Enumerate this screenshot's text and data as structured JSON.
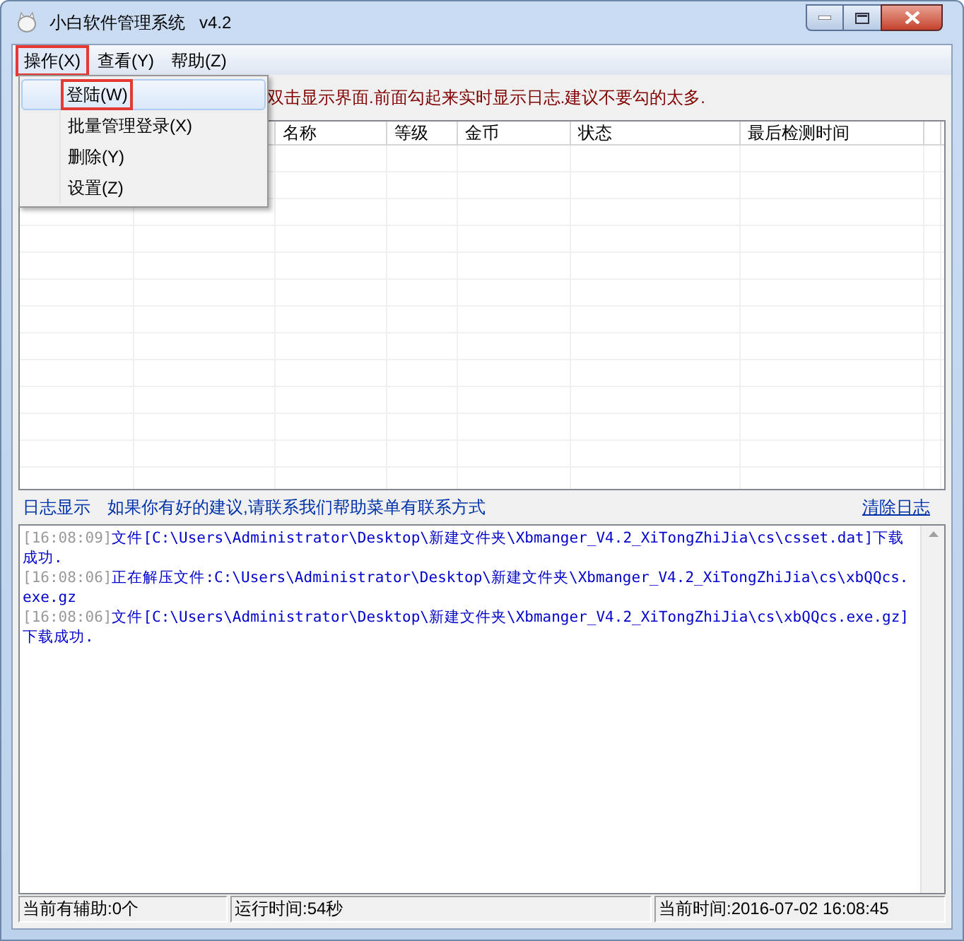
{
  "window": {
    "title": "小白软件管理系统   v4.2"
  },
  "menu_bar": [
    {
      "label": "操作(X)",
      "selected": true,
      "marked": true
    },
    {
      "label": "查看(Y)",
      "selected": false,
      "marked": false
    },
    {
      "label": "帮助(Z)",
      "selected": false,
      "marked": false
    }
  ],
  "dropdown": [
    {
      "label": "登陆(W)",
      "selected": true,
      "marked": true
    },
    {
      "label": "批量管理登录(X)",
      "selected": false,
      "marked": false
    },
    {
      "label": "删除(Y)",
      "selected": false,
      "marked": false
    },
    {
      "label": "设置(Z)",
      "selected": false,
      "marked": false
    }
  ],
  "notice": "双击显示界面.前面勾起来实时显示日志.建议不要勾的太多.",
  "table": {
    "columns": [
      "名称",
      "等级",
      "金币",
      "状态",
      "最后检测时间"
    ]
  },
  "log_bar": {
    "title": "日志显示",
    "hint": "如果你有好的建议,请联系我们帮助菜单有联系方式",
    "clear_link": "清除日志"
  },
  "log": [
    {
      "time": "[16:08:09]",
      "text": "文件[C:\\Users\\Administrator\\Desktop\\新建文件夹\\Xbmanger_V4.2_XiTongZhiJia\\cs\\csset.dat]下载成功."
    },
    {
      "time": "[16:08:06]",
      "text": "正在解压文件:C:\\Users\\Administrator\\Desktop\\新建文件夹\\Xbmanger_V4.2_XiTongZhiJia\\cs\\xbQQcs.exe.gz"
    },
    {
      "time": "[16:08:06]",
      "text": "文件[C:\\Users\\Administrator\\Desktop\\新建文件夹\\Xbmanger_V4.2_XiTongZhiJia\\cs\\xbQQcs.exe.gz]下载成功."
    }
  ],
  "status_bar": [
    "当前有辅助:0个",
    "运行时间:54秒",
    "当前时间:2016-07-02 16:08:45"
  ]
}
